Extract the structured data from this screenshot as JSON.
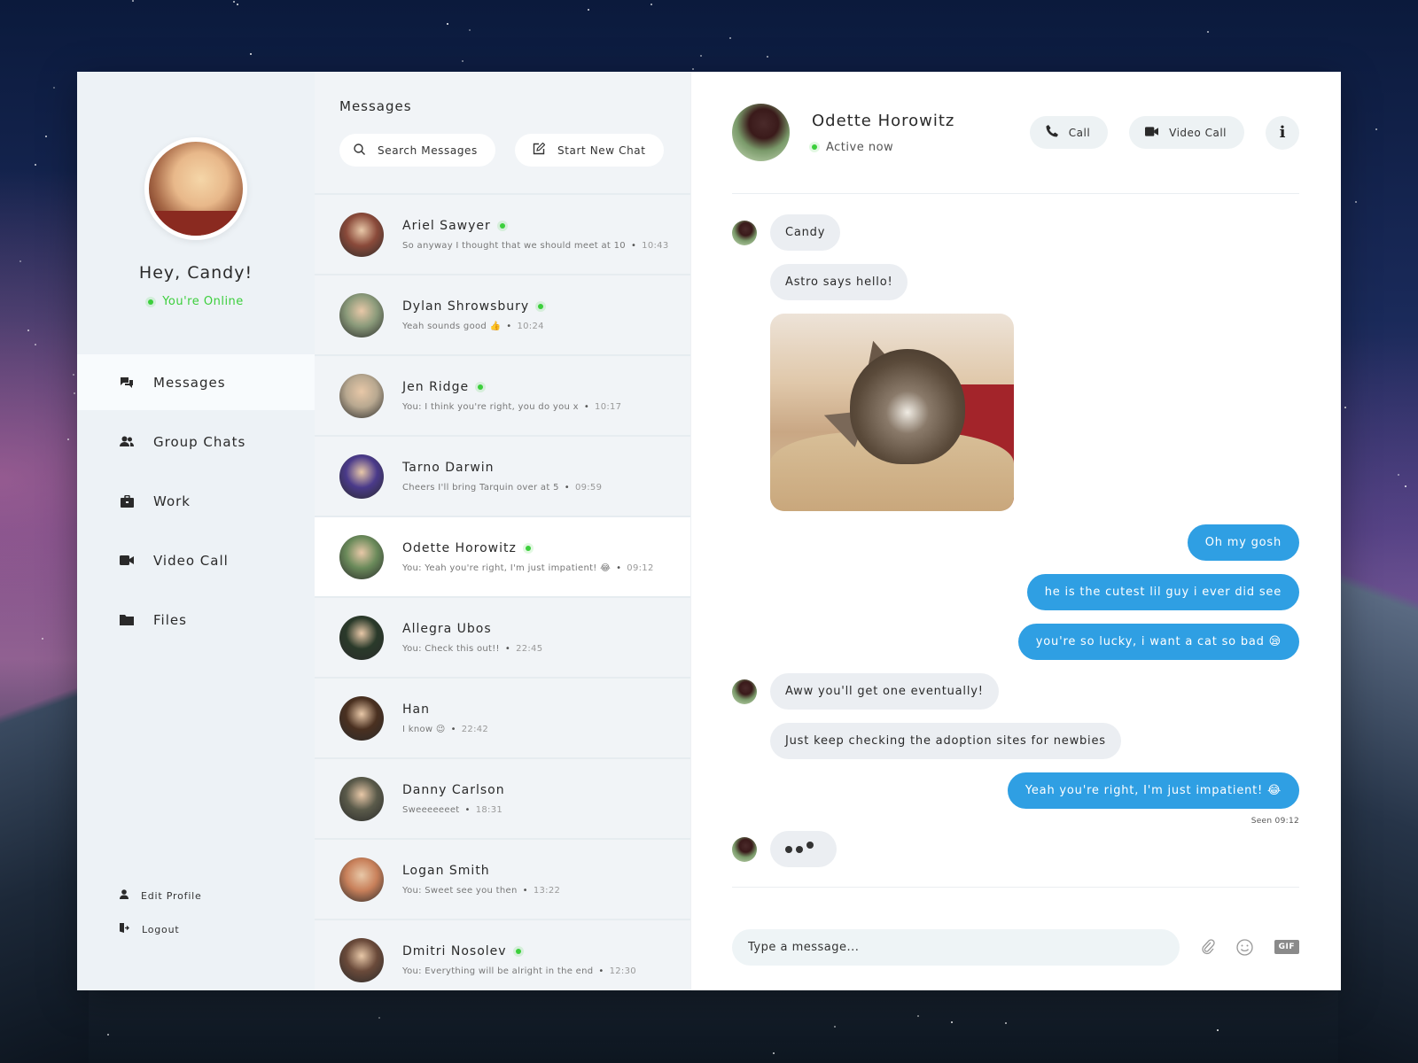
{
  "user": {
    "greeting": "Hey, Candy!",
    "status": "You're Online"
  },
  "nav": {
    "items": [
      {
        "id": "messages",
        "label": "Messages",
        "icon": "chat-bubbles-icon",
        "active": true
      },
      {
        "id": "group-chats",
        "label": "Group Chats",
        "icon": "users-icon",
        "active": false
      },
      {
        "id": "work",
        "label": "Work",
        "icon": "briefcase-icon",
        "active": false
      },
      {
        "id": "video-call",
        "label": "Video Call",
        "icon": "video-camera-icon",
        "active": false
      },
      {
        "id": "files",
        "label": "Files",
        "icon": "folder-icon",
        "active": false
      }
    ],
    "bottom": [
      {
        "id": "edit-profile",
        "label": "Edit Profile",
        "icon": "user-icon"
      },
      {
        "id": "logout",
        "label": "Logout",
        "icon": "logout-door-icon"
      }
    ]
  },
  "conversations": {
    "title": "Messages",
    "search_label": "Search Messages",
    "new_chat_label": "Start New Chat",
    "items": [
      {
        "name": "Ariel Sawyer",
        "online": true,
        "preview": "So anyway I thought that we should meet at 10",
        "time": "10:43",
        "active": false,
        "avatar_color": "#8a4a3a"
      },
      {
        "name": "Dylan Shrowsbury",
        "online": true,
        "preview": "Yeah sounds good 👍",
        "time": "10:24",
        "active": false,
        "avatar_color": "#8a9a7a"
      },
      {
        "name": "Jen Ridge",
        "online": true,
        "preview": "You: I think you're right, you do you x",
        "time": "10:17",
        "active": false,
        "avatar_color": "#b8a890"
      },
      {
        "name": "Tarno Darwin",
        "online": false,
        "preview": "Cheers I'll bring Tarquin over at 5",
        "time": "09:59",
        "active": false,
        "avatar_color": "#4a3a8a"
      },
      {
        "name": "Odette Horowitz",
        "online": true,
        "preview": "You: Yeah you're right, I'm just impatient! 😂",
        "time": "09:12",
        "active": true,
        "avatar_color": "#6a8a5a"
      },
      {
        "name": "Allegra Ubos",
        "online": false,
        "preview": "You: Check this out!!",
        "time": "22:45",
        "active": false,
        "avatar_color": "#2a3a2a"
      },
      {
        "name": "Han",
        "online": false,
        "preview": "I know 😉",
        "time": "22:42",
        "active": false,
        "avatar_color": "#4a3020"
      },
      {
        "name": "Danny Carlson",
        "online": false,
        "preview": "Sweeeeeeet",
        "time": "18:31",
        "active": false,
        "avatar_color": "#5a5a4a"
      },
      {
        "name": "Logan Smith",
        "online": false,
        "preview": "You: Sweet see you then",
        "time": "13:22",
        "active": false,
        "avatar_color": "#c8805a"
      },
      {
        "name": "Dmitri Nosolev",
        "online": true,
        "preview": "You: Everything will be alright in the end",
        "time": "12:30",
        "active": false,
        "avatar_color": "#6a4a3a"
      }
    ]
  },
  "chat": {
    "contact_name": "Odette Horowitz",
    "contact_status": "Active now",
    "call_label": "Call",
    "video_call_label": "Video Call",
    "messages": [
      {
        "dir": "in",
        "type": "text",
        "text": "Candy",
        "avatar": true
      },
      {
        "dir": "in",
        "type": "text",
        "text": "Astro says hello!",
        "avatar": false
      },
      {
        "dir": "in",
        "type": "image",
        "alt": "kitten photo",
        "avatar": false
      },
      {
        "dir": "out",
        "type": "text",
        "text": "Oh my gosh"
      },
      {
        "dir": "out",
        "type": "text",
        "text": "he is the cutest lil guy i ever did see"
      },
      {
        "dir": "out",
        "type": "text",
        "text": "you're so lucky, i want a cat so bad 😪"
      },
      {
        "dir": "in",
        "type": "text",
        "text": "Aww you'll get one eventually!",
        "avatar": true
      },
      {
        "dir": "in",
        "type": "text",
        "text": "Just keep checking the adoption sites for newbies",
        "avatar": false
      },
      {
        "dir": "out",
        "type": "text",
        "text": "Yeah you're right, I'm just impatient! 😂"
      }
    ],
    "seen_label": "Seen 09:12",
    "typing": true,
    "composer_placeholder": "Type a message...",
    "gif_label": "GIF"
  },
  "colors": {
    "accent_blue": "#2f9fe3",
    "online_green": "#3ccf3c",
    "sidebar_bg": "#edf2f6",
    "incoming_bubble": "#ebeef2"
  }
}
